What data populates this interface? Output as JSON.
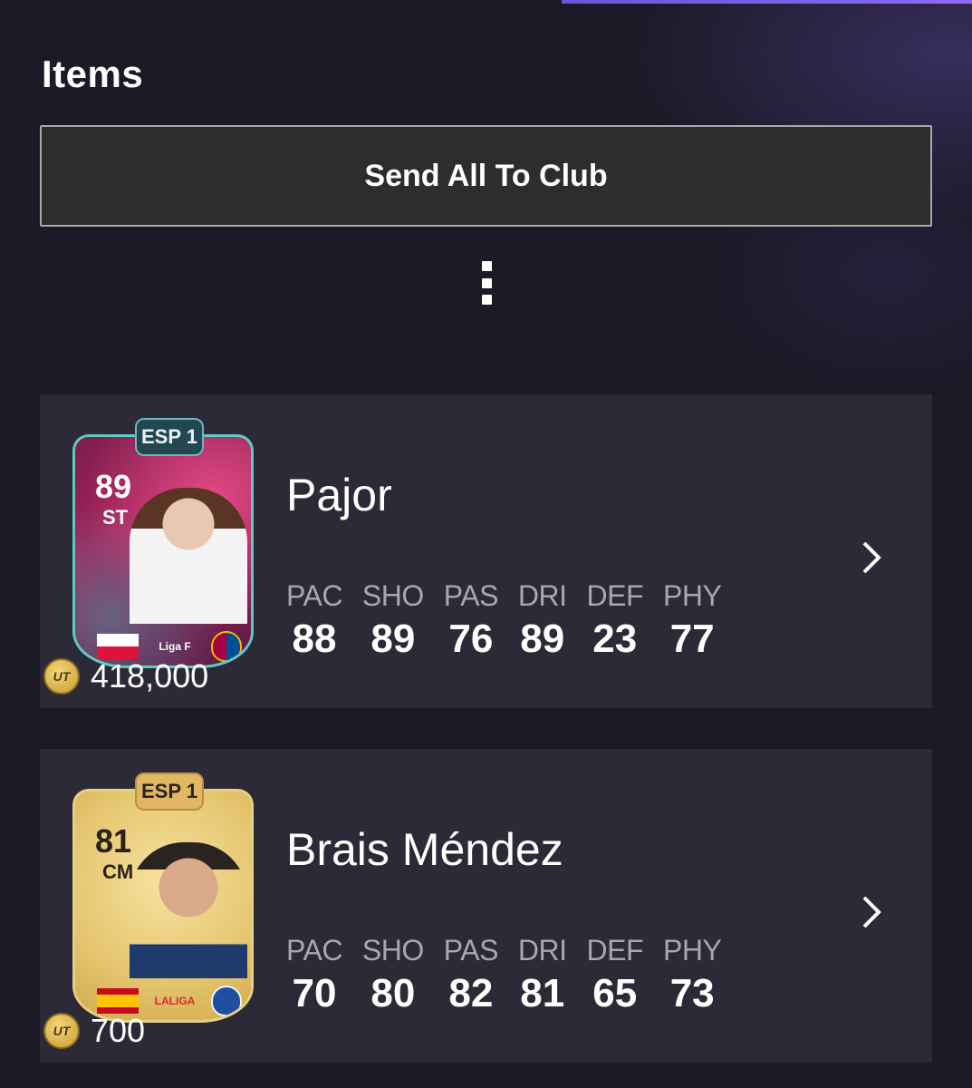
{
  "header": {
    "title": "Items"
  },
  "actions": {
    "send_all_label": "Send All To Club",
    "more_icon": "vertical-ellipsis-icon"
  },
  "items": [
    {
      "name": "Pajor",
      "rating": "89",
      "position": "ST",
      "league_badge": "ESP 1",
      "league_logo_text": "Liga F",
      "nation": "Poland",
      "club": "FC Barcelona",
      "price": "418,000",
      "coin_label": "UT",
      "card_style": "pink",
      "stats": [
        {
          "label": "PAC",
          "value": "88"
        },
        {
          "label": "SHO",
          "value": "89"
        },
        {
          "label": "PAS",
          "value": "76"
        },
        {
          "label": "DRI",
          "value": "89"
        },
        {
          "label": "DEF",
          "value": "23"
        },
        {
          "label": "PHY",
          "value": "77"
        }
      ]
    },
    {
      "name": "Brais Méndez",
      "rating": "81",
      "position": "CM",
      "league_badge": "ESP 1",
      "league_logo_text": "LALIGA",
      "nation": "Spain",
      "club": "Real Sociedad",
      "price": "700",
      "coin_label": "UT",
      "card_style": "gold",
      "stats": [
        {
          "label": "PAC",
          "value": "70"
        },
        {
          "label": "SHO",
          "value": "80"
        },
        {
          "label": "PAS",
          "value": "82"
        },
        {
          "label": "DRI",
          "value": "81"
        },
        {
          "label": "DEF",
          "value": "65"
        },
        {
          "label": "PHY",
          "value": "73"
        }
      ]
    }
  ],
  "colors": {
    "background": "#1b1a26",
    "row_background": "#2b2a36",
    "button_background": "#2d2d2d",
    "stat_label": "#a7a7b0"
  }
}
